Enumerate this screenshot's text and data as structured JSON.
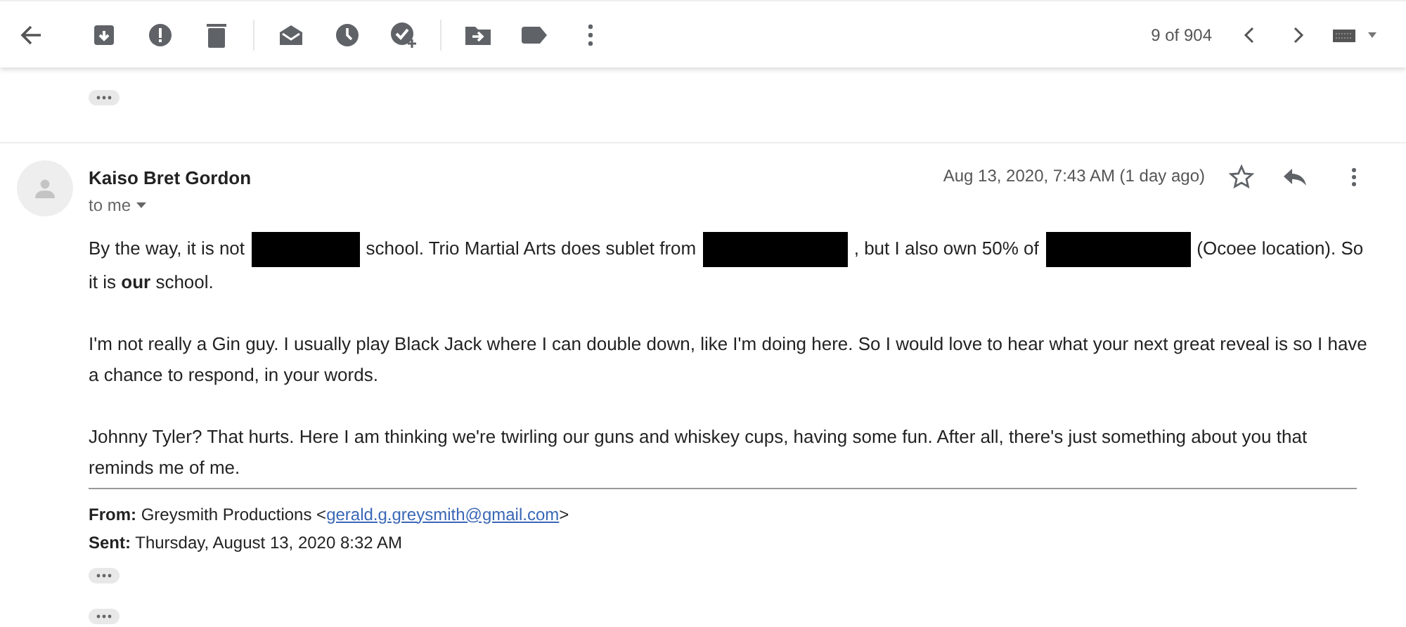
{
  "toolbar": {
    "counter": "9 of 904"
  },
  "message": {
    "sender": "Kaiso Bret Gordon",
    "recipient": "to me",
    "date": "Aug 13, 2020, 7:43 AM (1 day ago)",
    "starred": false,
    "paragraphs": [
      {
        "segments": [
          {
            "kind": "text",
            "text": "By the way, it is not"
          },
          {
            "kind": "redaction"
          },
          {
            "kind": "text",
            "text": "school. Trio Martial Arts does sublet from"
          },
          {
            "kind": "redaction"
          },
          {
            "kind": "text",
            "text": ", but I also own 50% of"
          },
          {
            "kind": "redaction"
          },
          {
            "kind": "text",
            "text": "(Ocoee location). So"
          },
          {
            "kind": "text",
            "text": "it is **our** school."
          }
        ]
      },
      {
        "segments": [
          {
            "kind": "text",
            "text": "I'm not really a Gin guy. I usually play Black Jack where I can double down, like I'm doing here. So I would love to hear what your next great reveal is so I have a chance to respond, in your words."
          }
        ]
      },
      {
        "segments": [
          {
            "kind": "text",
            "text": "Johnny Tyler? That hurts. Here I am thinking we're twirling our guns and whiskey cups, having some fun. After all, there's just something about you that reminds me of me."
          }
        ]
      }
    ],
    "quoted": {
      "from_label": "From:",
      "from_name": "Greysmith Productions",
      "email_open": "<",
      "email_close": ">",
      "from_email": "gerald.g.greysmith@gmail.com",
      "sent_label": "Sent:",
      "sent_value": "Thursday, August 13, 2020 8:32 AM"
    }
  }
}
